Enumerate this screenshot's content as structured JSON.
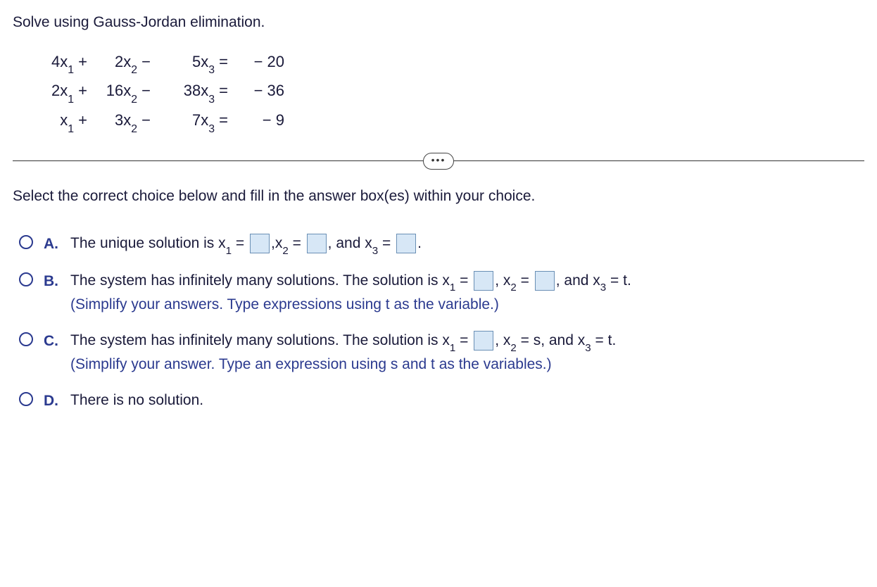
{
  "prompt": "Solve using Gauss-Jordan elimination.",
  "equations": {
    "r1": {
      "c1": "4x",
      "s1": "1",
      "op1": " +",
      "c2": "2x",
      "s2": "2",
      "op2": " −",
      "c3": "5x",
      "s3": "3",
      "eq": " =",
      "rhs": "− 20"
    },
    "r2": {
      "c1": "2x",
      "s1": "1",
      "op1": " +",
      "c2": "16x",
      "s2": "2",
      "op2": " −",
      "c3": "38x",
      "s3": "3",
      "eq": " =",
      "rhs": "− 36"
    },
    "r3": {
      "c1": "x",
      "s1": "1",
      "op1": " +",
      "c2": "3x",
      "s2": "2",
      "op2": " −",
      "c3": "7x",
      "s3": "3",
      "eq": " =",
      "rhs": "− 9"
    }
  },
  "instruction": "Select the correct choice below and fill in the answer box(es) within your choice.",
  "choices": {
    "a": {
      "label": "A.",
      "t1": "The unique solution is x",
      "t2": " = ",
      "t3": ",x",
      "t4": " = ",
      "t5": ", and x",
      "t6": " = ",
      "t7": "."
    },
    "b": {
      "label": "B.",
      "t1": "The system has infinitely many solutions. The solution is x",
      "t2": " = ",
      "t3": ", x",
      "t4": " = ",
      "t5": ", and x",
      "t6": " = t.",
      "hint": "(Simplify your answers. Type expressions using t as the variable.)"
    },
    "c": {
      "label": "C.",
      "t1": "The system has infinitely many solutions. The solution is x",
      "t2": " = ",
      "t3": ", x",
      "t4": " = s, and x",
      "t5": " = t.",
      "hint": "(Simplify your answer. Type an expression using s and t as the variables.)"
    },
    "d": {
      "label": "D.",
      "text": "There is no solution."
    }
  },
  "sub": {
    "one": "1",
    "two": "2",
    "three": "3"
  }
}
